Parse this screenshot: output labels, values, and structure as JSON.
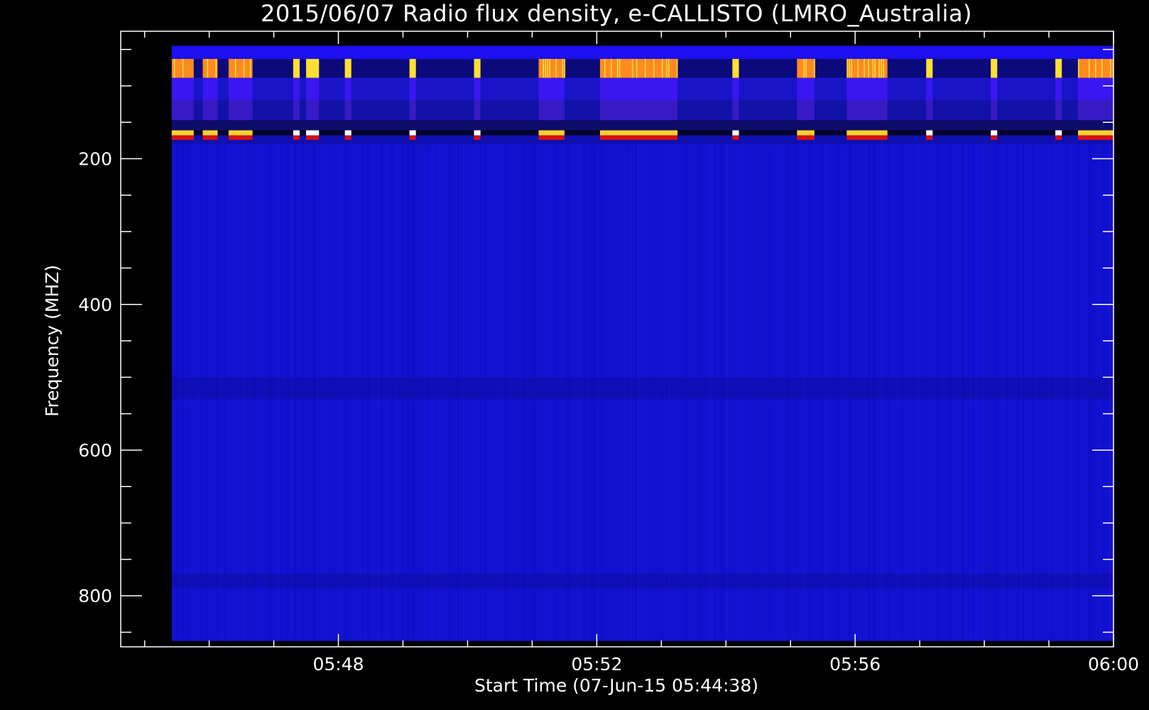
{
  "chart_data": {
    "type": "heatmap",
    "title": "2015/06/07  Radio flux density, e-CALLISTO (LMRO_Australia)",
    "xlabel": "Start Time (07-Jun-15 05:44:38)",
    "ylabel": "Frequency (MHZ)",
    "x_ticks": [
      "05:48",
      "05:52",
      "05:56",
      "06:00"
    ],
    "x_tick_minutes": [
      228,
      232,
      236,
      240
    ],
    "x_range_minutes": [
      224.63,
      240
    ],
    "x_data_range_minutes": [
      225.42,
      240.0
    ],
    "y_ticks": [
      "200",
      "400",
      "600",
      "800"
    ],
    "y_tick_values": [
      200,
      400,
      600,
      800
    ],
    "ylim": [
      25,
      870
    ],
    "y_data_range": [
      45,
      862
    ],
    "y_inverted": true,
    "colormap": [
      "#0a0a8c",
      "#1a10e0",
      "#3d18ff",
      "#c02010",
      "#ff6a10",
      "#ffa030",
      "#ffff40",
      "#ffffff"
    ],
    "background_color": "#1212d0",
    "bursts_minutes": [
      {
        "start": 225.42,
        "end": 225.76
      },
      {
        "start": 225.9,
        "end": 226.13
      },
      {
        "start": 226.3,
        "end": 226.67
      },
      {
        "start": 227.3,
        "end": 227.4
      },
      {
        "start": 227.5,
        "end": 227.7
      },
      {
        "start": 228.1,
        "end": 228.2
      },
      {
        "start": 229.1,
        "end": 229.2
      },
      {
        "start": 230.1,
        "end": 230.2
      },
      {
        "start": 231.1,
        "end": 231.5
      },
      {
        "start": 232.05,
        "end": 233.25
      },
      {
        "start": 234.1,
        "end": 234.2
      },
      {
        "start": 235.1,
        "end": 235.37
      },
      {
        "start": 235.87,
        "end": 236.5
      },
      {
        "start": 237.1,
        "end": 237.2
      },
      {
        "start": 238.1,
        "end": 238.2
      },
      {
        "start": 239.1,
        "end": 239.2
      },
      {
        "start": 239.45,
        "end": 240.0
      }
    ]
  }
}
